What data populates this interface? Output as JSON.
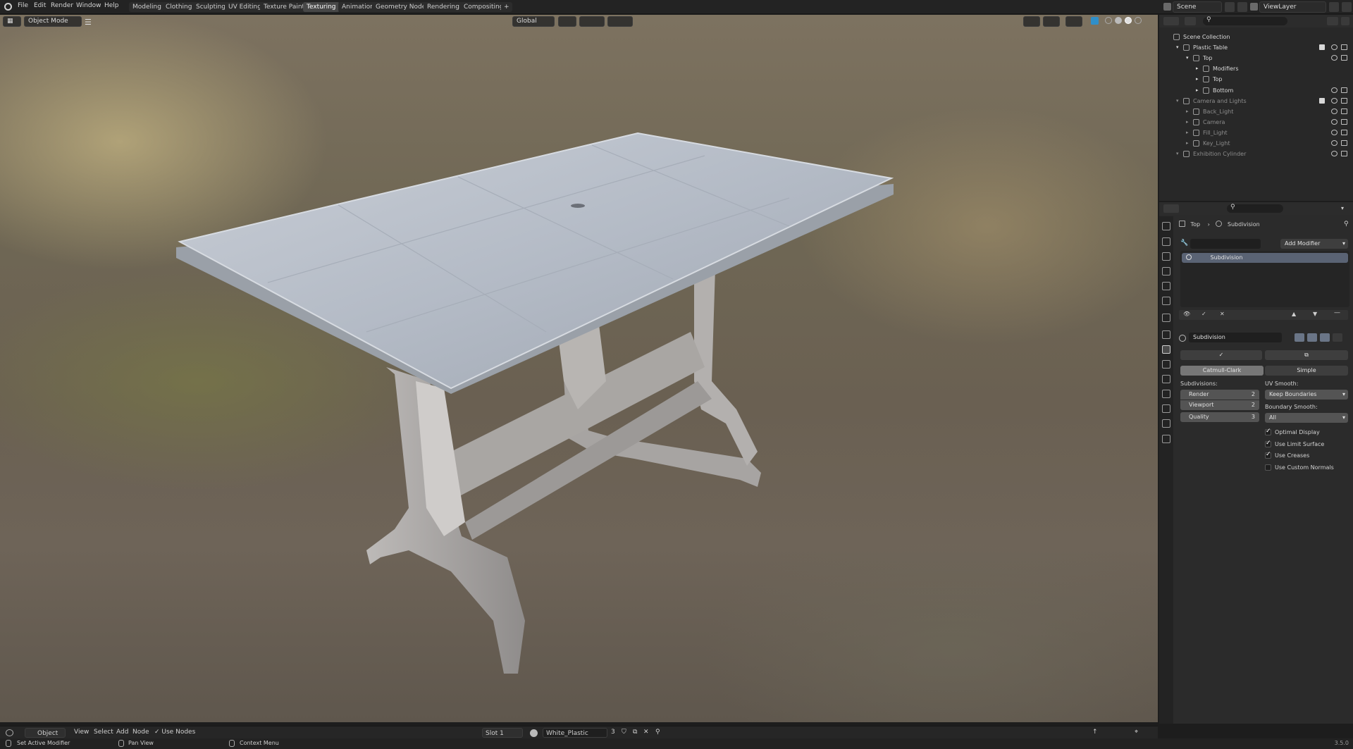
{
  "menu": [
    "File",
    "Edit",
    "Render",
    "Window",
    "Help"
  ],
  "workspaces": [
    {
      "label": "Modeling",
      "active": false
    },
    {
      "label": "Clothing",
      "active": false
    },
    {
      "label": "Sculpting",
      "active": false
    },
    {
      "label": "UV Editing",
      "active": false
    },
    {
      "label": "Texture Paint",
      "active": false
    },
    {
      "label": "Texturing",
      "active": true
    },
    {
      "label": "Animation",
      "active": false
    },
    {
      "label": "Geometry Nodes",
      "active": false
    },
    {
      "label": "Rendering",
      "active": false
    },
    {
      "label": "Compositing",
      "active": false
    }
  ],
  "top_right": {
    "scene": "Scene",
    "view_layer": "ViewLayer"
  },
  "viewport_header": {
    "mode": "Object Mode",
    "orientation": "Global"
  },
  "outliner": {
    "rows": [
      {
        "label": "Scene Collection",
        "indent": 0,
        "icon": "collection-icon",
        "dim": false
      },
      {
        "label": "Plastic Table",
        "indent": 1,
        "icon": "collection-icon",
        "dim": false
      },
      {
        "label": "Top",
        "indent": 2,
        "icon": "mesh-icon",
        "dim": false
      },
      {
        "label": "Modifiers",
        "indent": 3,
        "icon": "wrench-icon",
        "dim": false
      },
      {
        "label": "Top",
        "indent": 3,
        "icon": "mesh-data-icon",
        "dim": false
      },
      {
        "label": "Bottom",
        "indent": 3,
        "icon": "mesh-icon",
        "dim": false
      },
      {
        "label": "Camera and Lights",
        "indent": 1,
        "icon": "collection-icon",
        "dim": true
      },
      {
        "label": "Back_Light",
        "indent": 2,
        "icon": "light-icon",
        "dim": true
      },
      {
        "label": "Camera",
        "indent": 2,
        "icon": "camera-icon",
        "dim": true
      },
      {
        "label": "Fill_Light",
        "indent": 2,
        "icon": "light-icon",
        "dim": true
      },
      {
        "label": "Key_Light",
        "indent": 2,
        "icon": "light-icon",
        "dim": true
      },
      {
        "label": "Exhibition Cylinder",
        "indent": 1,
        "icon": "mesh-icon",
        "dim": true
      }
    ]
  },
  "properties": {
    "breadcrumb": {
      "object": "Top",
      "modifier": "Subdivision"
    },
    "add_modifier": "Add Modifier",
    "modifier_list_item": "Subdivision",
    "modifier_name": "Subdivision",
    "type_tabs": {
      "catmull": "Catmull-Clark",
      "simple": "Simple"
    },
    "subdivisions_label": "Subdivisions:",
    "render_label": "Render",
    "render_value": "2",
    "viewport_label": "Viewport",
    "viewport_value": "2",
    "quality_label": "Quality",
    "quality_value": "3",
    "uv_smooth_label": "UV Smooth:",
    "uv_smooth_value": "Keep Boundaries",
    "boundary_smooth_label": "Boundary Smooth:",
    "boundary_smooth_value": "All",
    "checks": [
      {
        "label": "Optimal Display",
        "on": true
      },
      {
        "label": "Use Limit Surface",
        "on": true
      },
      {
        "label": "Use Creases",
        "on": true
      },
      {
        "label": "Use Custom Normals",
        "on": false
      }
    ]
  },
  "bottom_header": {
    "editor": "Object",
    "menus": [
      "View",
      "Select",
      "Add",
      "Node"
    ],
    "use_nodes": "Use Nodes",
    "slot": "Slot 1",
    "material": "White_Plastic",
    "users": "3"
  },
  "status_bar": {
    "left": "Set Active Modifier",
    "mid": "Pan View",
    "right": "Context Menu",
    "version": "3.5.0"
  }
}
